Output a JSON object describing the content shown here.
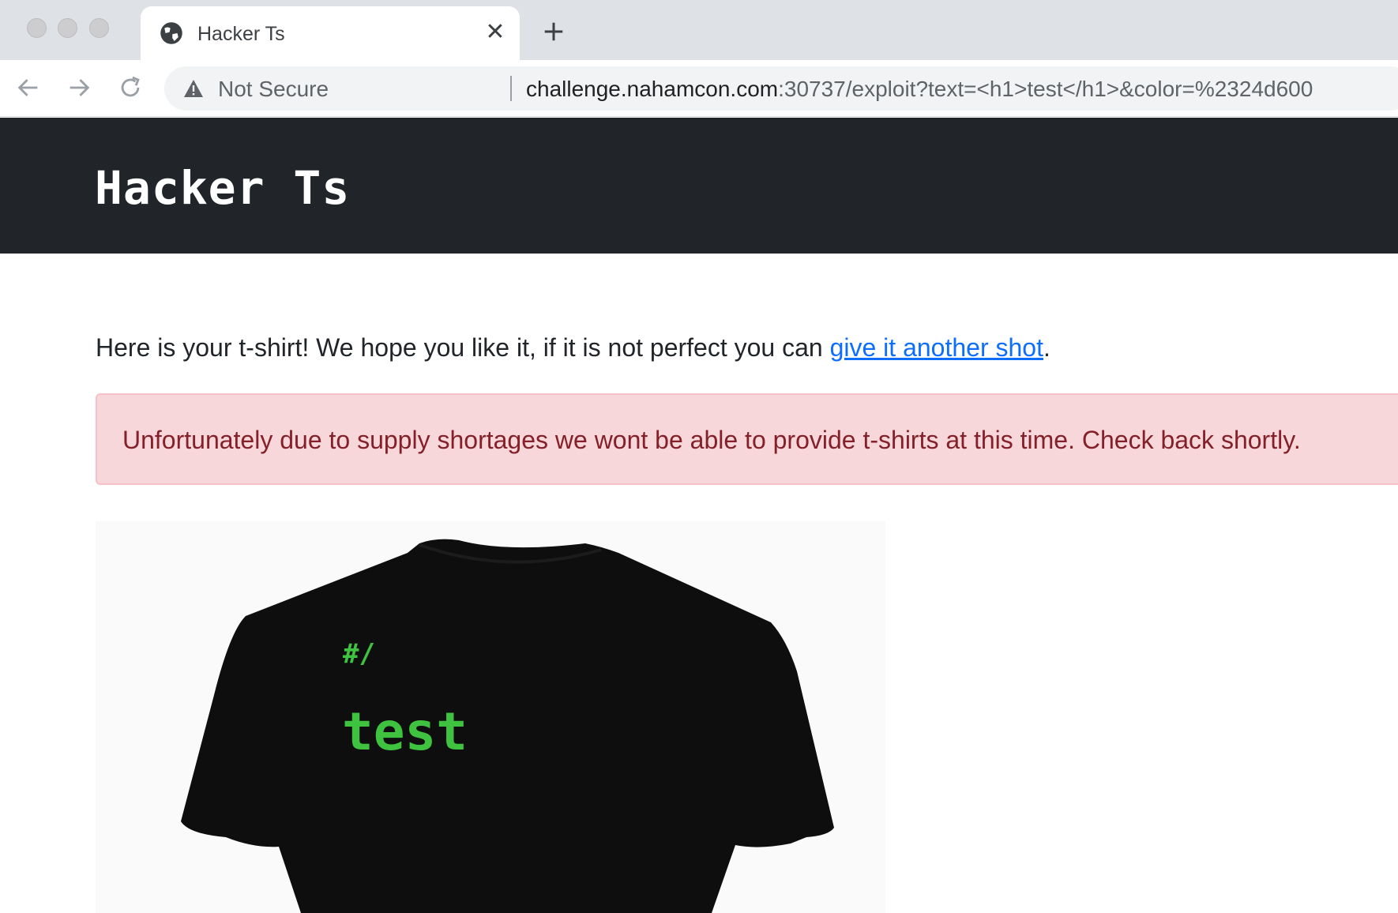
{
  "browser": {
    "tab_title": "Hacker Ts",
    "close_glyph": "✕",
    "security_label": "Not Secure",
    "url_host": "challenge.nahamcon.com",
    "url_rest": ":30737/exploit?text=<h1>test</h1>&color=%2324d600"
  },
  "site": {
    "brand": "Hacker Ts"
  },
  "main": {
    "intro_text": "Here is your t-shirt! We hope you like it, if it is not perfect you can ",
    "intro_link": "give it another shot",
    "intro_end": ".",
    "alert": "Unfortunately due to supply shortages we wont be able to provide t-shirts at this time. Check back shortly.",
    "shirt_prefix": "#/",
    "shirt_text": "test",
    "shirt_text_color": "#24d600"
  }
}
